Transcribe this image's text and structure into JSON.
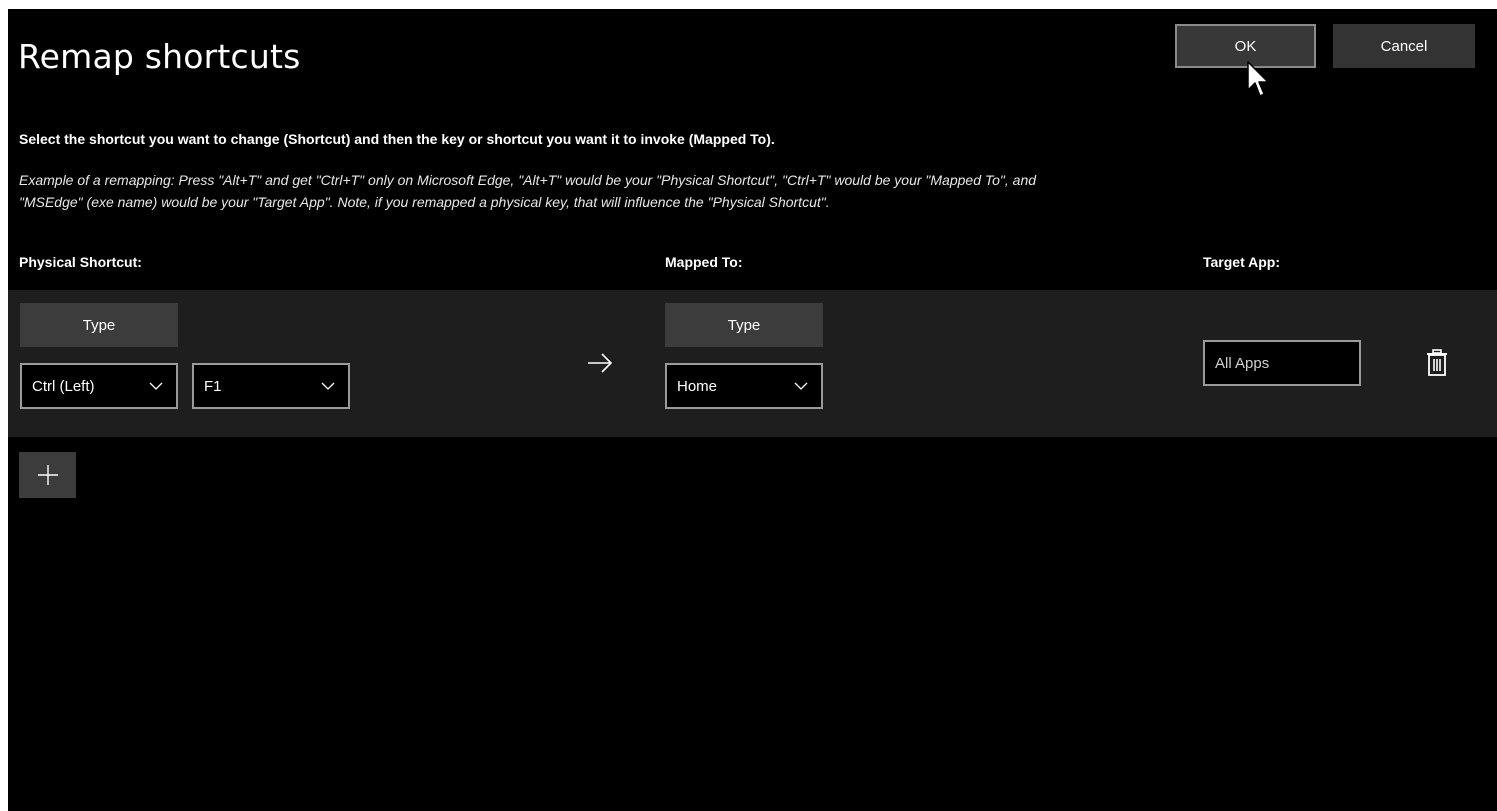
{
  "dialog": {
    "title": "Remap shortcuts",
    "ok_label": "OK",
    "cancel_label": "Cancel",
    "instruction": "Select the shortcut you want to change (Shortcut) and then the key or shortcut you want it to invoke (Mapped To).",
    "example_line1": "Example of a remapping: Press \"Alt+T\" and get \"Ctrl+T\" only on Microsoft Edge, \"Alt+T\" would be your \"Physical Shortcut\", \"Ctrl+T\" would be your \"Mapped To\", and",
    "example_line2": "\"MSEdge\" (exe name) would be your \"Target App\". Note, if you remapped a physical key, that will influence the \"Physical Shortcut\"."
  },
  "columns": {
    "physical": "Physical Shortcut:",
    "mapped": "Mapped To:",
    "target": "Target App:"
  },
  "rows": [
    {
      "physical_type_label": "Type",
      "physical_keys": [
        "Ctrl (Left)",
        "F1"
      ],
      "arrow_icon": "arrow-right-icon",
      "mapped_type_label": "Type",
      "mapped_keys": [
        "Home"
      ],
      "target_app_placeholder": "All Apps",
      "delete_icon": "trash-icon"
    }
  ],
  "add_icon": "plus-icon",
  "colors": {
    "background": "#000000",
    "row_band": "#1e1e1e",
    "button": "#3c3c3c",
    "border": "#9a9a9a"
  }
}
